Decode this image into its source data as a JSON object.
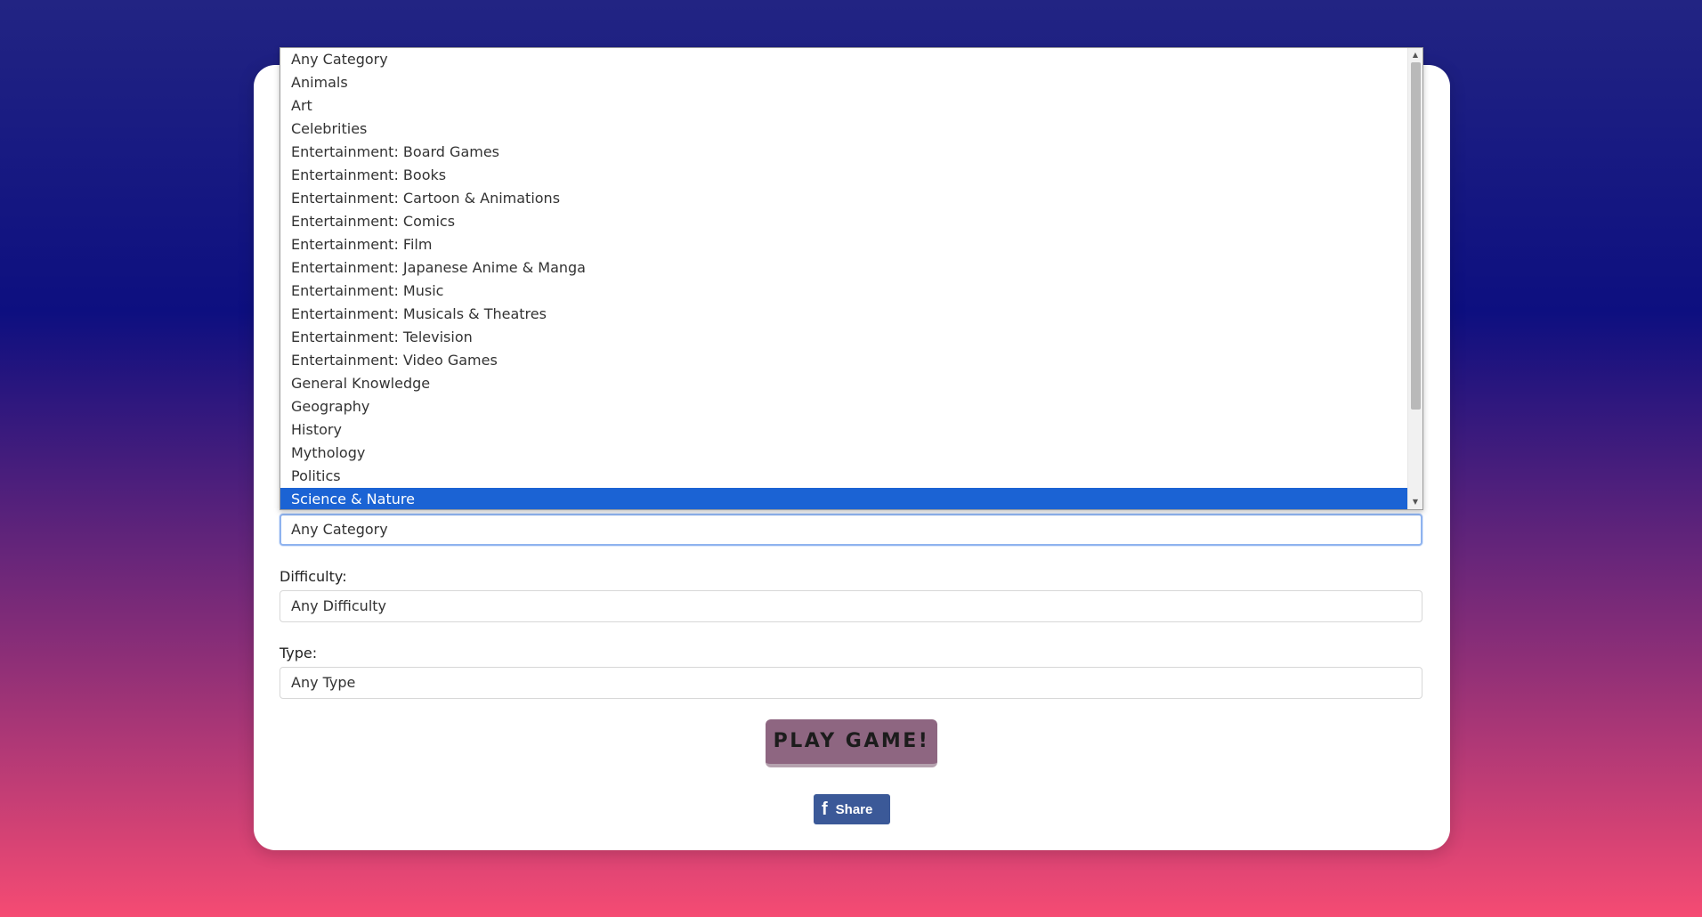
{
  "form": {
    "category": {
      "value": "Any Category",
      "options": [
        "Any Category",
        "Animals",
        "Art",
        "Celebrities",
        "Entertainment: Board Games",
        "Entertainment: Books",
        "Entertainment: Cartoon & Animations",
        "Entertainment: Comics",
        "Entertainment: Film",
        "Entertainment: Japanese Anime & Manga",
        "Entertainment: Music",
        "Entertainment: Musicals & Theatres",
        "Entertainment: Television",
        "Entertainment: Video Games",
        "General Knowledge",
        "Geography",
        "History",
        "Mythology",
        "Politics",
        "Science & Nature"
      ],
      "highlighted": "Science & Nature"
    },
    "difficulty": {
      "label": "Difficulty:",
      "value": "Any Difficulty"
    },
    "type": {
      "label": "Type:",
      "value": "Any Type"
    },
    "play_button": "PLAY GAME!",
    "share_button": "Share"
  },
  "icons": {
    "facebook": "facebook-f-icon",
    "scroll_up": "scroll-up-arrow-icon",
    "scroll_down": "scroll-down-arrow-icon"
  },
  "colors": {
    "highlight": "#1b63d4",
    "play_button_bg": "#8e6681",
    "facebook_blue": "#3b5998"
  }
}
